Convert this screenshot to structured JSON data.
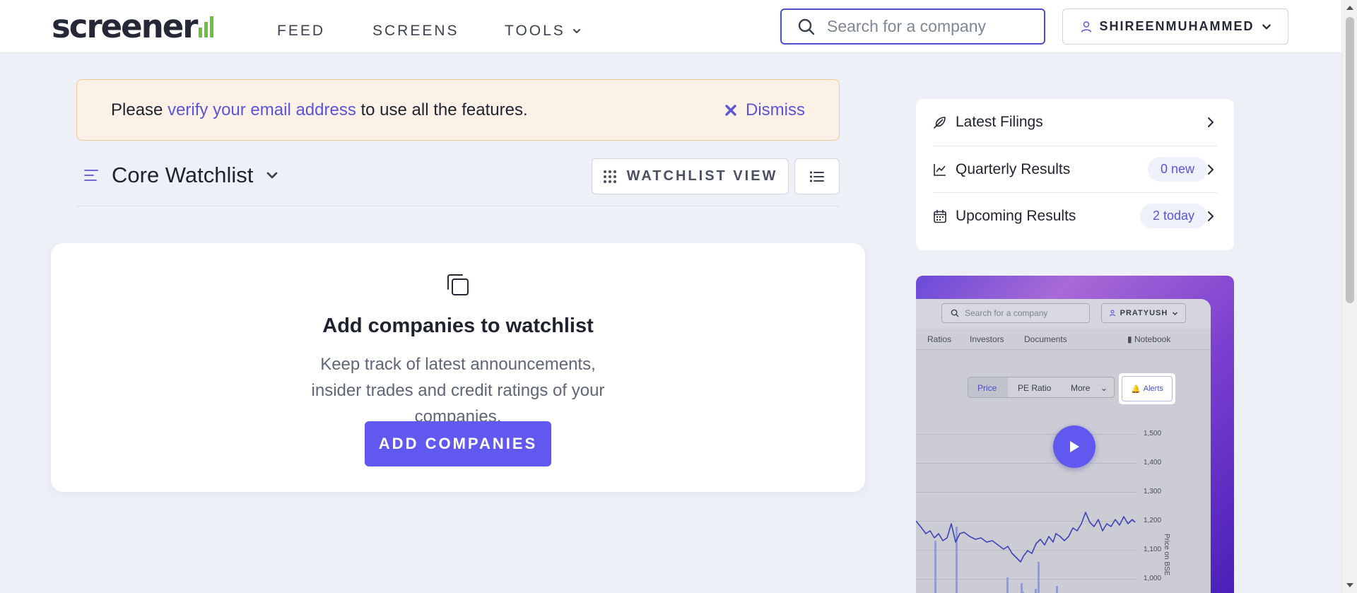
{
  "nav": {
    "logo_text": "screener",
    "links": [
      "FEED",
      "SCREENS",
      "TOOLS"
    ],
    "search_placeholder": "Search for a company",
    "user_name": "SHIREENMUHAMMED"
  },
  "banner": {
    "prefix": "Please",
    "link_text": "verify your email address",
    "suffix": "to use all the features.",
    "dismiss_label": "Dismiss"
  },
  "watchlist": {
    "title": "Core Watchlist",
    "view_button": "WATCHLIST VIEW"
  },
  "empty_state": {
    "title": "Add companies to watchlist",
    "text": "Keep track of latest announcements, insider trades and credit ratings of your companies.",
    "button": "ADD COMPANIES"
  },
  "side": {
    "items": [
      {
        "label": "Latest Filings",
        "icon": "feather-icon"
      },
      {
        "label": "Quarterly Results",
        "badge": "0 new",
        "icon": "line-chart-icon"
      },
      {
        "label": "Upcoming Results",
        "badge": "2 today",
        "icon": "calendar-icon"
      }
    ]
  },
  "promo": {
    "search_placeholder": "Search for a company",
    "user": "PRATYUSH",
    "tabs": [
      "Ratios",
      "Investors",
      "Documents",
      "Notebook"
    ],
    "chips": [
      "Price",
      "PE Ratio",
      "More"
    ],
    "alert_label": "Alerts",
    "y_ticks": [
      "1,500",
      "1,400",
      "1,300",
      "1,200",
      "1,100",
      "1,000"
    ],
    "y_label": "Price on BSE"
  },
  "colors": {
    "accent": "#6159ef",
    "link": "#5b55d6",
    "logo_green": "#6ac13a",
    "banner_bg": "#fbf1e7",
    "page_bg": "#edf0f7"
  }
}
